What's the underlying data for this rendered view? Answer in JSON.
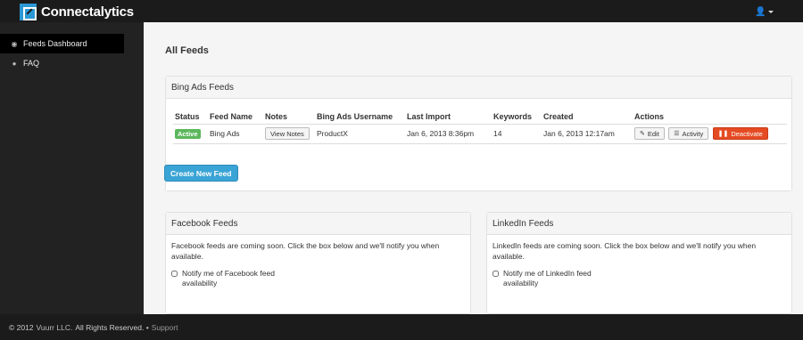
{
  "brand": {
    "name": "Connectalytics",
    "logo_icon": "connectalytics-logo-icon"
  },
  "topbar": {
    "user_icon": "user-icon"
  },
  "sidebar": {
    "items": [
      {
        "label": "Feeds Dashboard",
        "icon": "rss-icon",
        "glyph": "◉",
        "active": true
      },
      {
        "label": "FAQ",
        "icon": "info-icon",
        "glyph": "●",
        "active": false
      }
    ]
  },
  "main": {
    "title": "All Feeds",
    "bing_panel": {
      "heading": "Bing Ads Feeds",
      "columns": [
        "Status",
        "Feed Name",
        "Notes",
        "Bing Ads Username",
        "Last Import",
        "Keywords",
        "Created",
        "Actions"
      ],
      "rows": [
        {
          "status": "Active",
          "feed_name": "Bing Ads",
          "notes_button": "View Notes",
          "username": "ProductX",
          "last_import": "Jan 6, 2013 8:36pm",
          "keywords": "14",
          "created": "Jan 6, 2013 12:17am",
          "actions": {
            "edit": "Edit",
            "activity": "Activity",
            "deactivate": "Deactivate"
          }
        }
      ],
      "create_button": "Create New Feed"
    },
    "facebook_panel": {
      "heading": "Facebook Feeds",
      "text": "Facebook feeds are coming soon. Click the box below and we'll notify you when available.",
      "checkbox_label": "Notify me of Facebook feed availability"
    },
    "linkedin_panel": {
      "heading": "LinkedIn Feeds",
      "text": "LinkedIn feeds are coming soon. Click the box below and we'll notify you when available.",
      "checkbox_label": "Notify me of LinkedIn feed availability"
    }
  },
  "footer": {
    "copyright": "© 2012",
    "company": "Vuurr LLC.",
    "rights": "All Rights Reserved. •",
    "support": "Support"
  },
  "colors": {
    "accent": "#2b98d5",
    "success": "#5bb75b",
    "danger": "#e54b23",
    "primary_button": "#3aa4d6",
    "topbar": "#1b1b1b"
  }
}
